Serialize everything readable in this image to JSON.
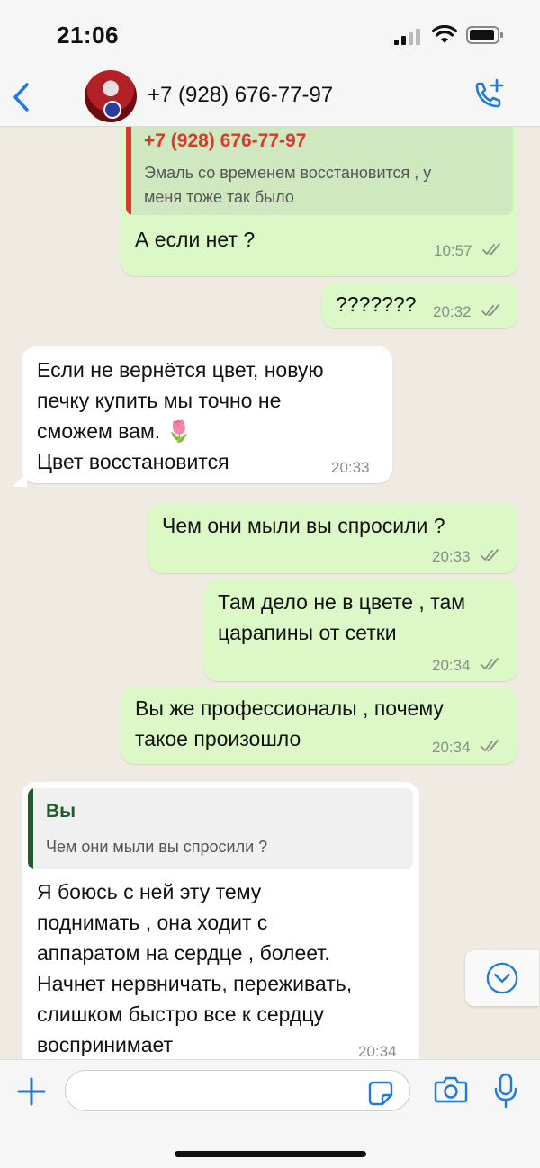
{
  "status_bar": {
    "time": "21:06"
  },
  "header": {
    "contact": "+7 (928) 676-77-97"
  },
  "messages": [
    {
      "direction": "out",
      "quote": {
        "name": "+7 (928) 676-77-97",
        "text": "Эмаль со временем восстановится , у\nменя тоже так было",
        "color": "#d93a2b"
      },
      "text": "А если нет ?",
      "time": "10:57",
      "status": "read"
    },
    {
      "direction": "out",
      "text": "???????",
      "time": "20:32",
      "status": "read"
    },
    {
      "direction": "in",
      "text": "Если не вернётся цвет, новую\nпечку купить мы точно не\nсможем вам. 🌷\nЦвет восстановится",
      "time": "20:33"
    },
    {
      "direction": "out",
      "text": "Чем они мыли вы спросили ?",
      "time": "20:33",
      "status": "read"
    },
    {
      "direction": "out",
      "text": "Там дело не в цвете , там\nцарапины от сетки",
      "time": "20:34",
      "status": "read"
    },
    {
      "direction": "out",
      "text": "Вы же профессионалы , почему\nтакое произошло",
      "time": "20:34",
      "status": "read"
    },
    {
      "direction": "in",
      "quote": {
        "name": "Вы",
        "text": "Чем они мыли вы спросили ?",
        "color": "#1f5d2a"
      },
      "text": "Я боюсь с ней эту тему\nподнимать , она ходит с\nаппаратом на сердце , болеет.\nНачнет нервничать, переживать,\nслишком быстро все к сердцу\nвоспринимает",
      "time": "20:34"
    }
  ],
  "colors": {
    "outgoing_bubble": "#dcf8c6",
    "incoming_bubble": "#ffffff",
    "chat_background": "#efeae2",
    "accent_blue": "#1f7ae0"
  },
  "icons": {
    "back": "chevron-left-icon",
    "call": "phone-plus-icon",
    "scroll": "chevron-down-circle-icon",
    "attach": "plus-icon",
    "sticker": "sticker-icon",
    "camera": "camera-icon",
    "mic": "microphone-icon"
  }
}
